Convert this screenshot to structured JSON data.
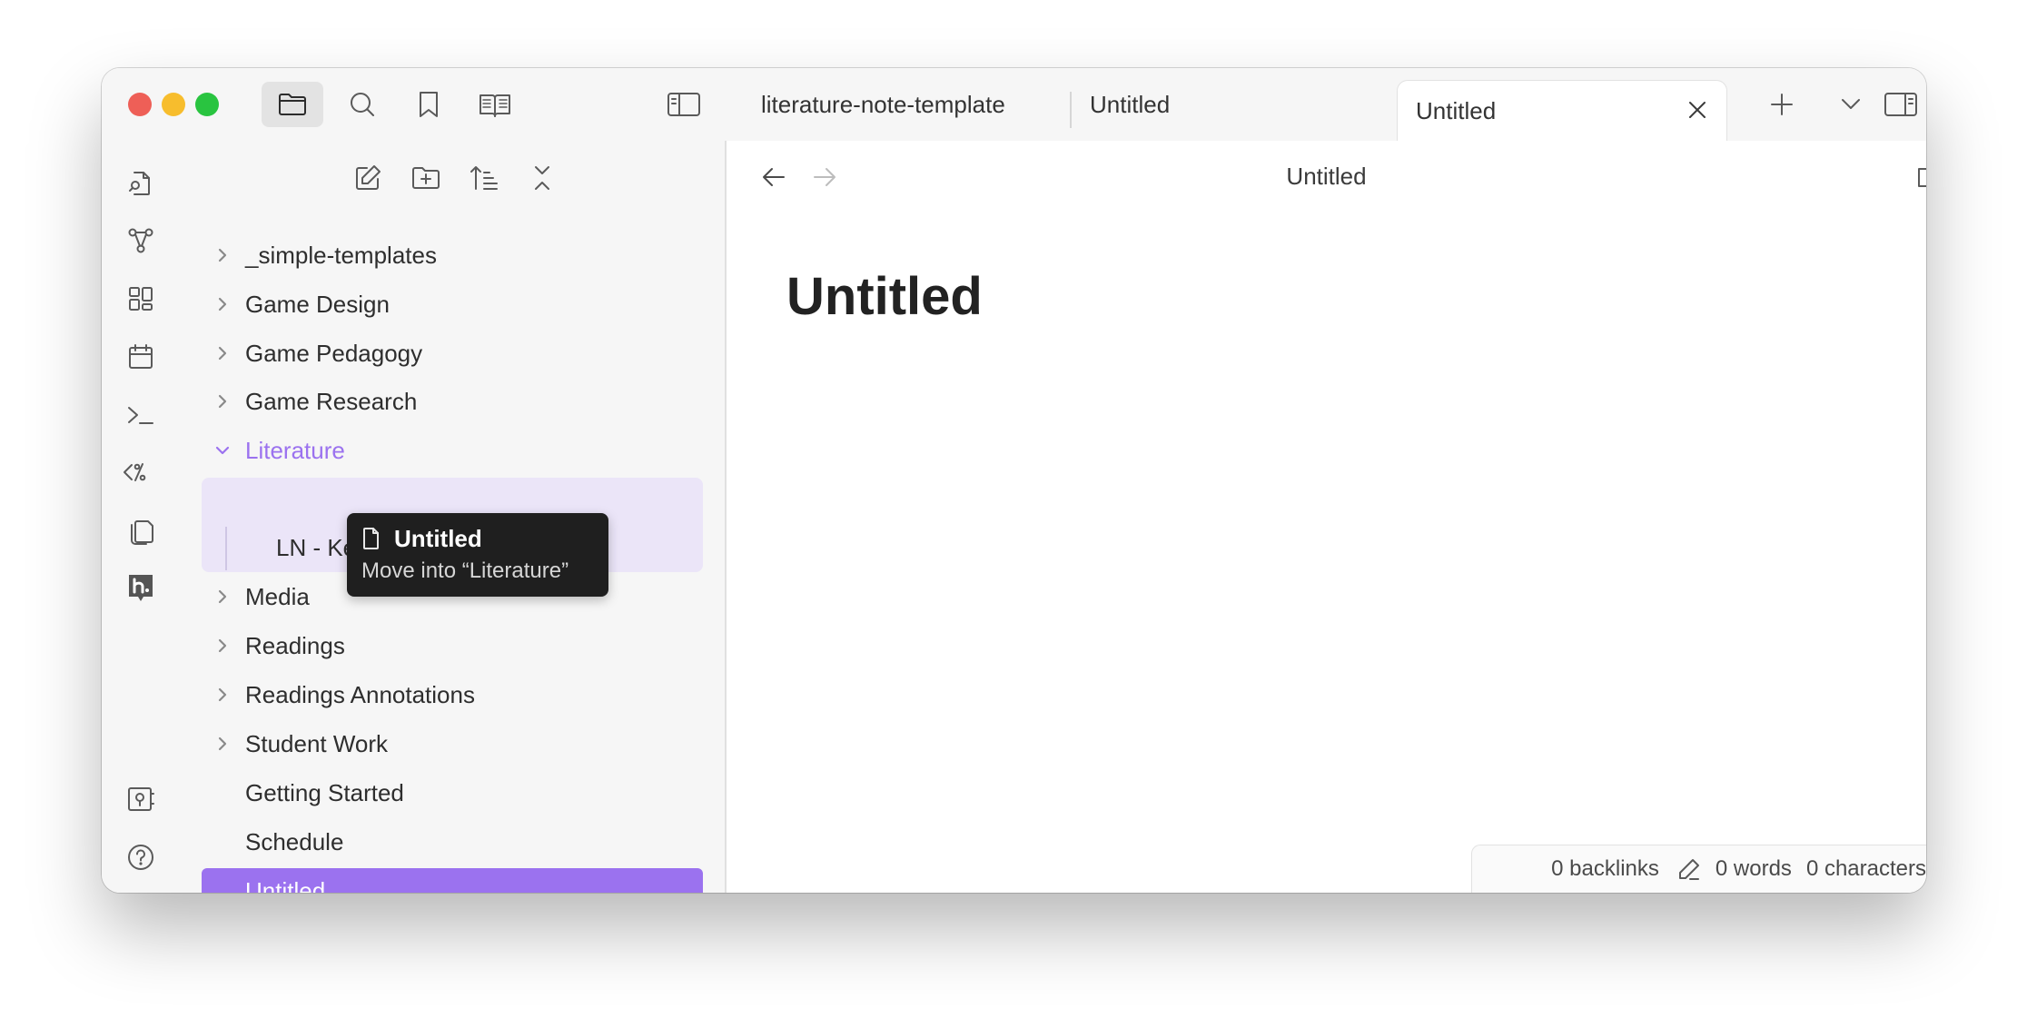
{
  "tabs": [
    {
      "label": "literature-note-template"
    },
    {
      "label": "Untitled"
    },
    {
      "label": "Untitled"
    }
  ],
  "file_tree": {
    "items": [
      {
        "label": "_simple-templates"
      },
      {
        "label": "Game Design"
      },
      {
        "label": "Game Pedagogy"
      },
      {
        "label": "Game Research"
      },
      {
        "label": "Literature"
      },
      {
        "label": "LN - Ke... et al. 2009"
      },
      {
        "label": "Media"
      },
      {
        "label": "Readings"
      },
      {
        "label": "Readings Annotations"
      },
      {
        "label": "Student Work"
      },
      {
        "label": "Getting Started"
      },
      {
        "label": "Schedule"
      },
      {
        "label": "Untitled"
      }
    ]
  },
  "drag_tooltip": {
    "file": "Untitled",
    "action": "Move into “Literature”"
  },
  "editor": {
    "view_title": "Untitled",
    "note_title": "Untitled"
  },
  "status_bar": {
    "backlinks": "0 backlinks",
    "words": "0 words",
    "characters": "0 characters"
  },
  "colors": {
    "accent": "#9b72ef",
    "accent_soft": "#ebe5f8",
    "traffic_red": "#ee5f57",
    "traffic_yellow": "#f7bd2d",
    "traffic_green": "#29c440"
  },
  "icons": {
    "ribbon": [
      "quick-switcher-icon",
      "graph-view-icon",
      "canvas-icon",
      "daily-note-icon",
      "command-palette-icon",
      "templater-icon",
      "templates-icon",
      "hypothesis-icon",
      "vault-switcher-icon",
      "help-icon",
      "settings-icon"
    ],
    "file_explorer_toolbar": [
      "new-note-icon",
      "new-folder-icon",
      "sort-icon",
      "collapse-all-icon"
    ]
  }
}
